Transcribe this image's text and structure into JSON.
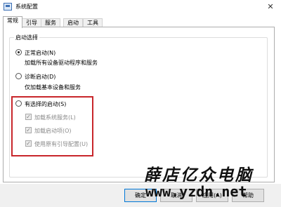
{
  "window": {
    "title": "系统配置",
    "close_glyph": "✕"
  },
  "tabs": [
    {
      "label": "常规",
      "active": true
    },
    {
      "label": "引导"
    },
    {
      "label": "服务"
    },
    {
      "label": "启动"
    },
    {
      "label": "工具"
    }
  ],
  "startup_selection": {
    "group_label": "启动选择",
    "normal": {
      "label": "正常启动(N)",
      "description": "加载所有设备驱动程序和服务",
      "selected": true
    },
    "diagnostic": {
      "label": "诊断启动(D)",
      "description": "仅加载基本设备和服务",
      "selected": false
    },
    "selective": {
      "label": "有选择的启动(S)",
      "selected": false,
      "options": [
        {
          "label": "加载系统服务(L)",
          "checked": true,
          "disabled": true
        },
        {
          "label": "加载启动项(O)",
          "checked": true,
          "disabled": true
        },
        {
          "label": "使用原有引导配置(U)",
          "checked": true,
          "disabled": true
        }
      ]
    },
    "highlight_color": "#c8262b"
  },
  "buttons": {
    "ok": "确定",
    "cancel": "取消",
    "apply": "应用(A)",
    "help": "帮助"
  },
  "watermark": {
    "text": "薛店亿众电脑",
    "url": "www.yzdn.net"
  },
  "check_glyph": "✓"
}
